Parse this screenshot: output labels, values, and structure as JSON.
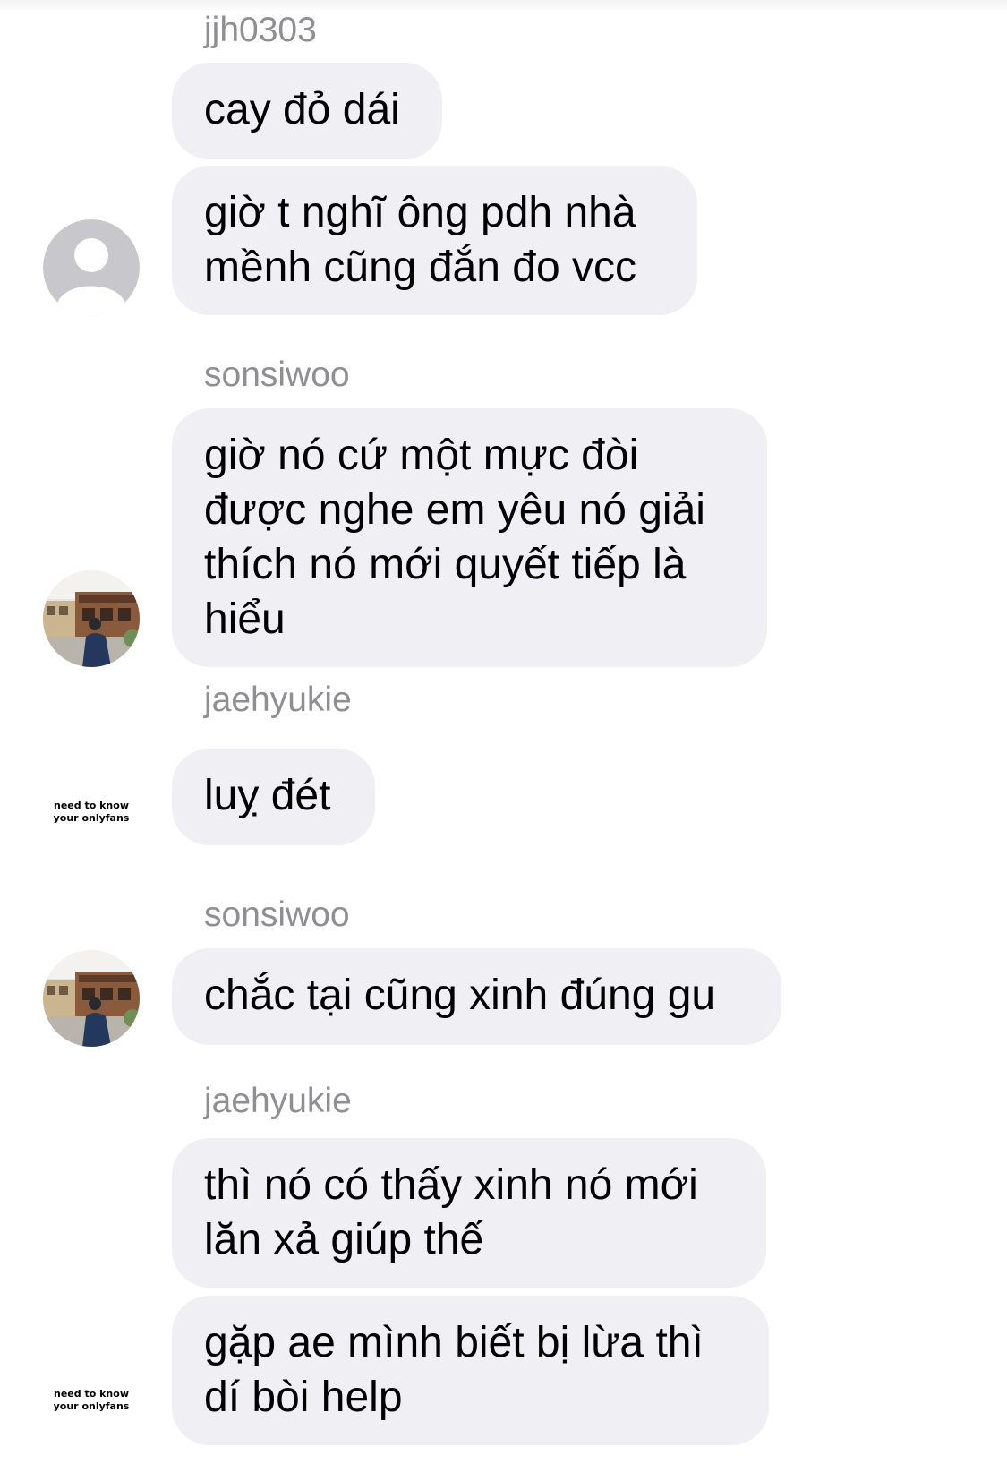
{
  "messages": [
    {
      "sender": "jjh0303",
      "bubbles": [
        "cay đỏ dái",
        "giờ t nghĩ ông pdh nhà\nmềnh cũng đắn đo vcc"
      ]
    },
    {
      "sender": "sonsiwoo",
      "bubbles": [
        "giờ nó cứ một mực đòi\nđược nghe em yêu nó giải\nthích nó mới quyết tiếp là\nhiểu"
      ]
    },
    {
      "sender": "jaehyukie",
      "bubbles": [
        "luỵ đét"
      ],
      "avatar_text": [
        "need to know",
        "your onlyfans"
      ]
    },
    {
      "sender": "sonsiwoo",
      "bubbles": [
        "chắc tại cũng xinh đúng gu"
      ]
    },
    {
      "sender": "jaehyukie",
      "bubbles": [
        "thì nó có thấy xinh nó mới\nlăn xả giúp thế",
        "gặp ae mình biết bị lừa thì\ndí bòi help"
      ],
      "avatar_text": [
        "need to know",
        "your onlyfans"
      ]
    }
  ],
  "colors": {
    "bubble": "#efeff4",
    "sender": "#8e8e93",
    "default_avatar": "#c7c7cc"
  },
  "icons": {
    "default_avatar": "person-silhouette-icon"
  }
}
